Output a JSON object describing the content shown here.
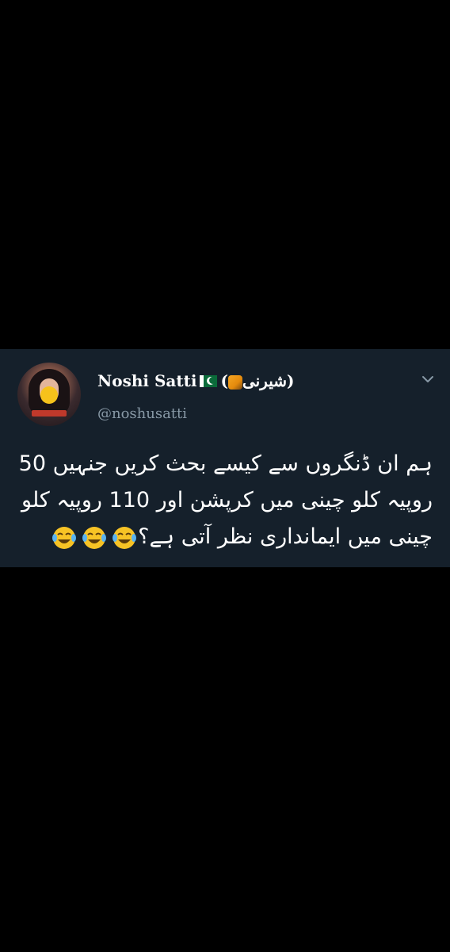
{
  "tweet": {
    "author": {
      "display_name": "Noshi Satti",
      "flag_icon": "pakistan-flag-icon",
      "name_suffix_open": "(",
      "name_suffix_text": "شیرنی",
      "name_suffix_close": ")",
      "tiger_icon": "tiger-emoji-icon",
      "handle": "@noshusatti"
    },
    "menu_icon": "chevron-down-icon",
    "text": "ہم ان ڈنگروں سے کیسے بحث کریں جنہیں 50 روپیہ کلو چینی میں کرپشن اور 110 روپیہ کلو چینی میں ایمانداری نظر آتی ہے؟",
    "trailing_emoji": [
      "face-with-tears-of-joy-icon",
      "face-with-tears-of-joy-icon",
      "face-with-tears-of-joy-icon"
    ]
  },
  "colors": {
    "page_background": "#000000",
    "card_background": "#15202b",
    "primary_text": "#ffffff",
    "secondary_text": "#8899a6"
  }
}
